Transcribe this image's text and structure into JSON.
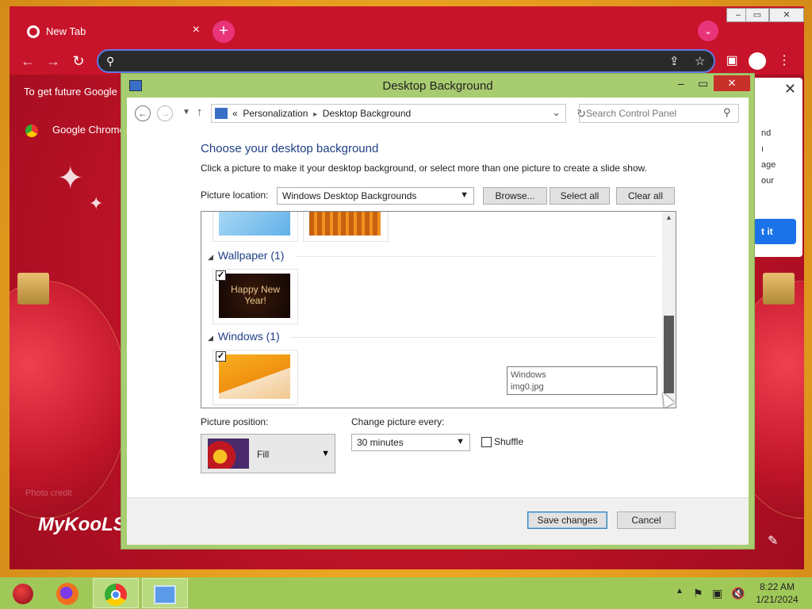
{
  "browser": {
    "tab_title": "New Tab",
    "tab_close": "×",
    "new_tab": "+",
    "bookmark_bar_text": "To get future Google",
    "side_link": "Google Chrome",
    "brand_text": "MyKooLS",
    "faint_text": "Photo credit"
  },
  "popup": {
    "close": "✕",
    "lines": [
      "nd",
      "ı",
      "age",
      "our"
    ],
    "button": "t it"
  },
  "dialog": {
    "title": "Desktop Background",
    "close": "✕",
    "breadcrumb": {
      "prefix": "«",
      "items": [
        "Personalization",
        "Desktop Background"
      ],
      "separator": "▸"
    },
    "search_placeholder": "Search Control Panel",
    "heading": "Choose your desktop background",
    "subtext": "Click a picture to make it your desktop background, or select more than one picture to create a slide show.",
    "picture_location_label": "Picture location:",
    "picture_location_value": "Windows Desktop Backgrounds",
    "browse_button": "Browse...",
    "select_all_button": "Select all",
    "clear_all_button": "Clear all",
    "groups": [
      {
        "name": "Wallpaper (1)",
        "thumb_text": "Happy New Year!",
        "checked": true
      },
      {
        "name": "Windows (1)",
        "checked": true
      }
    ],
    "tooltip": {
      "line1": "Windows",
      "line2": "img0.jpg"
    },
    "picture_position_label": "Picture position:",
    "picture_position_value": "Fill",
    "change_picture_label": "Change picture every:",
    "change_picture_value": "30 minutes",
    "shuffle_label": "Shuffle",
    "shuffle_checked": false,
    "save_button": "Save changes",
    "cancel_button": "Cancel"
  },
  "taskbar": {
    "time": "8:22 AM",
    "date": "1/21/2024"
  }
}
